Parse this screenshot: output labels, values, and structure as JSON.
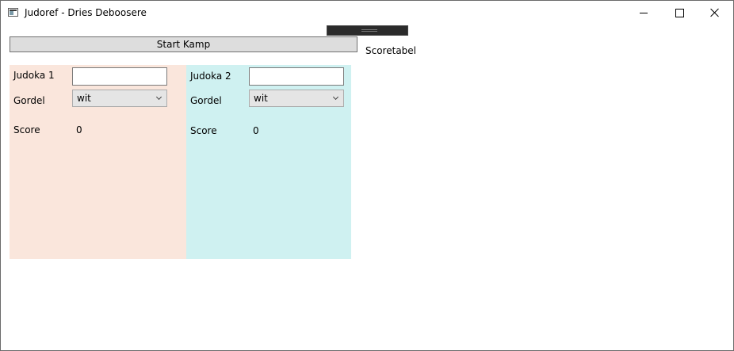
{
  "window": {
    "title": "Judoref - Dries Deboosere",
    "controls": {
      "minimize": "minimize",
      "maximize": "maximize",
      "close": "close"
    }
  },
  "toolbar": {
    "start_label": "Start Kamp",
    "scoretabel_label": "Scoretabel"
  },
  "judoka1": {
    "name_label": "Judoka 1",
    "name_value": "",
    "belt_label": "Gordel",
    "belt_value": "wit",
    "score_label": "Score",
    "score_value": "0",
    "color": "#fae6dc"
  },
  "judoka2": {
    "name_label": "Judoka 2",
    "name_value": "",
    "belt_label": "Gordel",
    "belt_value": "wit",
    "score_label": "Score",
    "score_value": "0",
    "color": "#cff1f1"
  }
}
